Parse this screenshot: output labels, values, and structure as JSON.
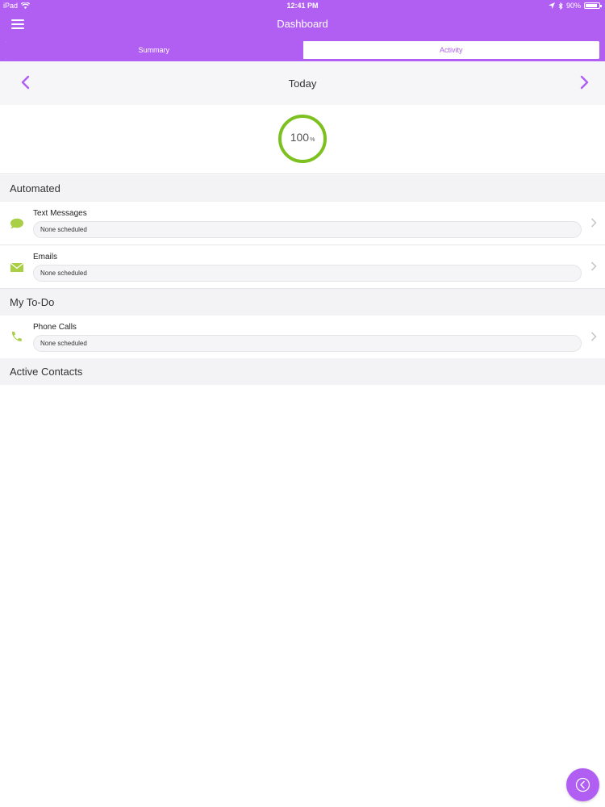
{
  "status_bar": {
    "device": "iPad",
    "time": "12:41 PM",
    "battery": "90%",
    "battery_level": 0.9
  },
  "header": {
    "title": "Dashboard"
  },
  "tabs": [
    {
      "label": "Summary",
      "active": true
    },
    {
      "label": "Activity",
      "active": false
    }
  ],
  "date_nav": {
    "label": "Today"
  },
  "progress": {
    "value": "100",
    "unit": "%",
    "fraction": 1.0,
    "color": "#7cc11f"
  },
  "sections": {
    "automated": {
      "title": "Automated",
      "items": [
        {
          "title": "Text Messages",
          "status": "None scheduled",
          "icon": "chat-bubble-icon"
        },
        {
          "title": "Emails",
          "status": "None scheduled",
          "icon": "envelope-icon"
        }
      ]
    },
    "todo": {
      "title": "My To-Do",
      "items": [
        {
          "title": "Phone Calls",
          "status": "None scheduled",
          "icon": "phone-icon"
        }
      ]
    },
    "active_contacts": {
      "title": "Active Contacts"
    }
  },
  "colors": {
    "accent": "#b15ff2",
    "icon_green": "#a8cf45",
    "ring_green": "#7cc11f"
  },
  "fab": {
    "icon": "circle-chevron-left-icon"
  }
}
